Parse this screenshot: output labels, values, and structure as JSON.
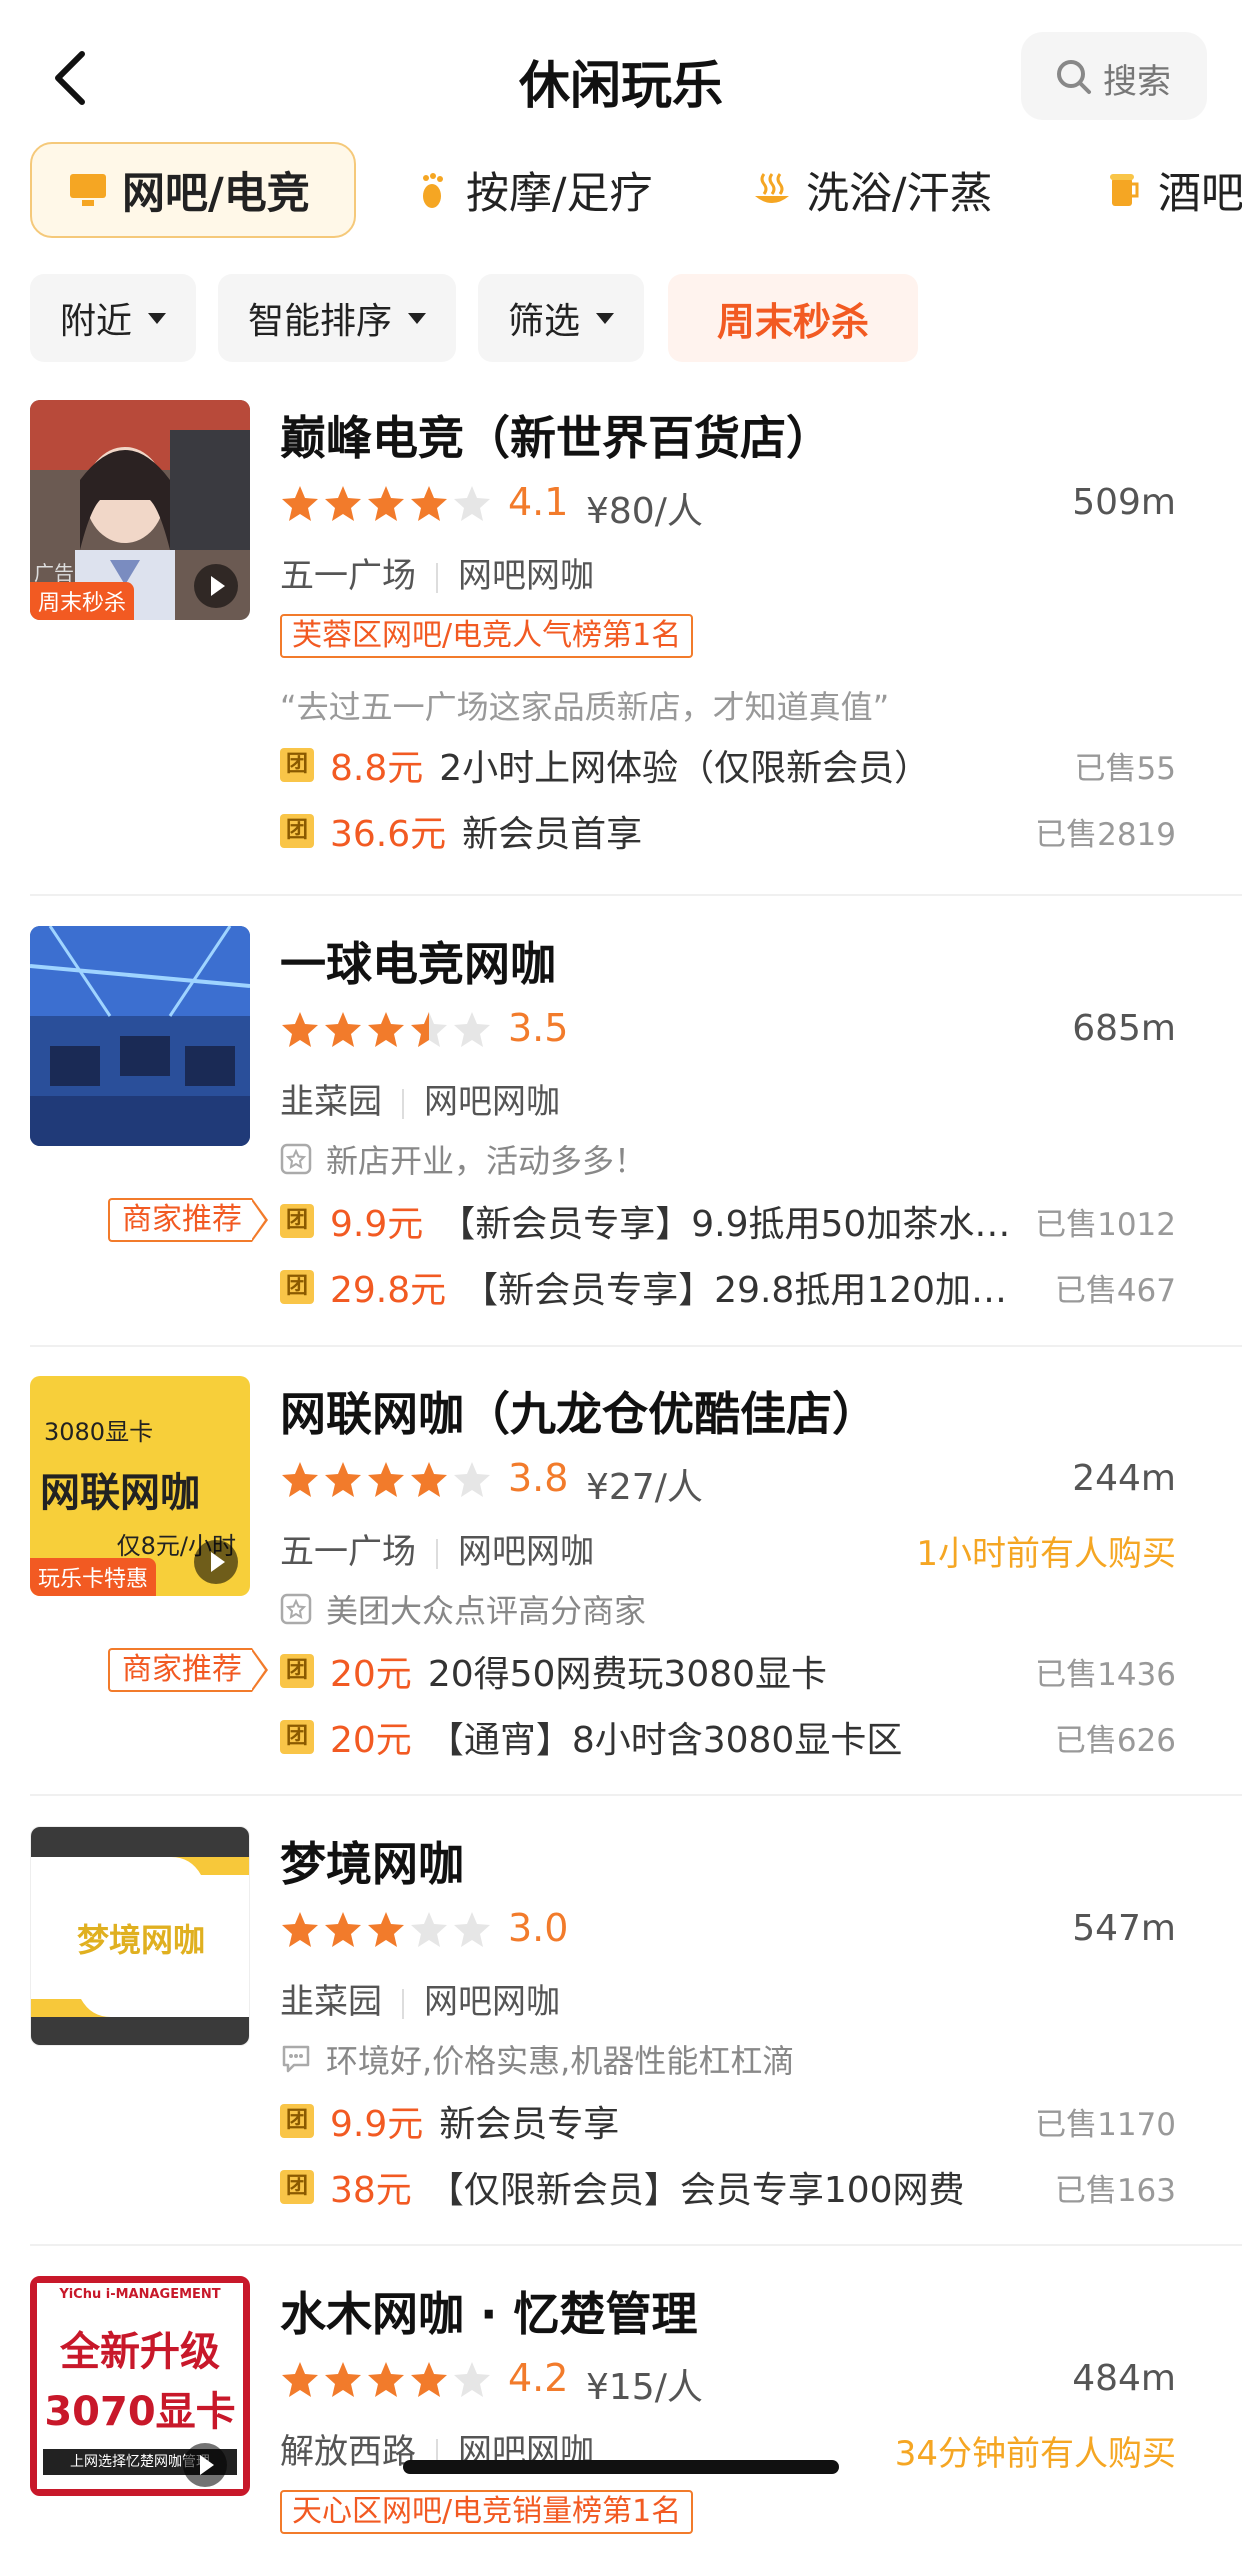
{
  "header": {
    "title": "休闲玩乐",
    "search_label": "搜索"
  },
  "categories": [
    {
      "label": "网吧/电竞",
      "icon": "monitor-icon",
      "active": true
    },
    {
      "label": "按摩/足疗",
      "icon": "foot-icon",
      "active": false
    },
    {
      "label": "洗浴/汗蒸",
      "icon": "hot-spring-icon",
      "active": false
    },
    {
      "label": "酒吧",
      "icon": "beer-icon",
      "active": false
    }
  ],
  "filters": {
    "nearby": "附近",
    "sort": "智能排序",
    "filter": "筛选",
    "promo": "周末秒杀"
  },
  "colors": {
    "accent": "#f25a22",
    "star": "#f27b2b",
    "star_empty": "#e6e6e6",
    "tuan": "#f9c548",
    "recent": "#f5a623"
  },
  "shops": [
    {
      "name": "巅峰电竞（新世界百货店）",
      "rating": 4.1,
      "score": "4.1",
      "price": "¥80/人",
      "distance": "509m",
      "area": "五一广场",
      "category": "网吧网咖",
      "rank": "芙蓉区网吧/电竞人气榜第1名",
      "quote": "“去过五一广场这家品质新店，才知道真值”",
      "thumb_tag": "周末秒杀",
      "thumb_ad": "广告",
      "deals": [
        {
          "price": "8.8元",
          "title": "2小时上网体验（仅限新会员）",
          "sold": "已售55"
        },
        {
          "price": "36.6元",
          "title": "新会员首享",
          "sold": "已售2819"
        }
      ]
    },
    {
      "name": "一球电竞网咖",
      "rating": 3.5,
      "score": "3.5",
      "price": "",
      "distance": "685m",
      "area": "韭菜园",
      "category": "网吧网咖",
      "feature": "新店开业，活动多多！",
      "recommend": "商家推荐",
      "deals": [
        {
          "price": "9.9元",
          "title": "【新会员专享】9.9抵用50加茶水…",
          "sold": "已售1012"
        },
        {
          "price": "29.8元",
          "title": "【新会员专享】29.8抵用120加茶…",
          "sold": "已售467"
        }
      ]
    },
    {
      "name": "网联网咖（九龙仓优酷佳店）",
      "rating": 3.8,
      "score": "3.8",
      "price": "¥27/人",
      "distance": "244m",
      "area": "五一广场",
      "category": "网吧网咖",
      "recent": "1小时前有人购买",
      "feature": "美团大众点评高分商家",
      "recommend": "商家推荐",
      "thumb_top": "3080显卡",
      "thumb_main": "网联网咖",
      "thumb_sub": "仅8元/小时",
      "thumb_tag": "玩乐卡特惠",
      "deals": [
        {
          "price": "20元",
          "title": "20得50网费玩3080显卡",
          "sold": "已售1436"
        },
        {
          "price": "20元",
          "title": "【通宵】8小时含3080显卡区",
          "sold": "已售626"
        }
      ]
    },
    {
      "name": "梦境网咖",
      "rating": 3.0,
      "score": "3.0",
      "price": "",
      "distance": "547m",
      "area": "韭菜园",
      "category": "网吧网咖",
      "feature": "环境好,价格实惠,机器性能杠杠滴",
      "thumb_main": "梦境网咖",
      "deals": [
        {
          "price": "9.9元",
          "title": "新会员专享",
          "sold": "已售1170"
        },
        {
          "price": "38元",
          "title": "【仅限新会员】会员专享100网费",
          "sold": "已售163"
        }
      ]
    },
    {
      "name": "水木网咖 · 忆楚管理",
      "rating": 4.2,
      "score": "4.2",
      "price": "¥15/人",
      "distance": "484m",
      "area": "解放西路",
      "category": "网吧网咖",
      "recent": "34分钟前有人购买",
      "rank": "天心区网吧/电竞销量榜第1名",
      "thumb_top": "YiChu i-MANAGEMENT",
      "thumb_main": "全新升级",
      "thumb_sub": "3070显卡",
      "thumb_bottom": "上网选择忆楚网咖管理"
    }
  ]
}
